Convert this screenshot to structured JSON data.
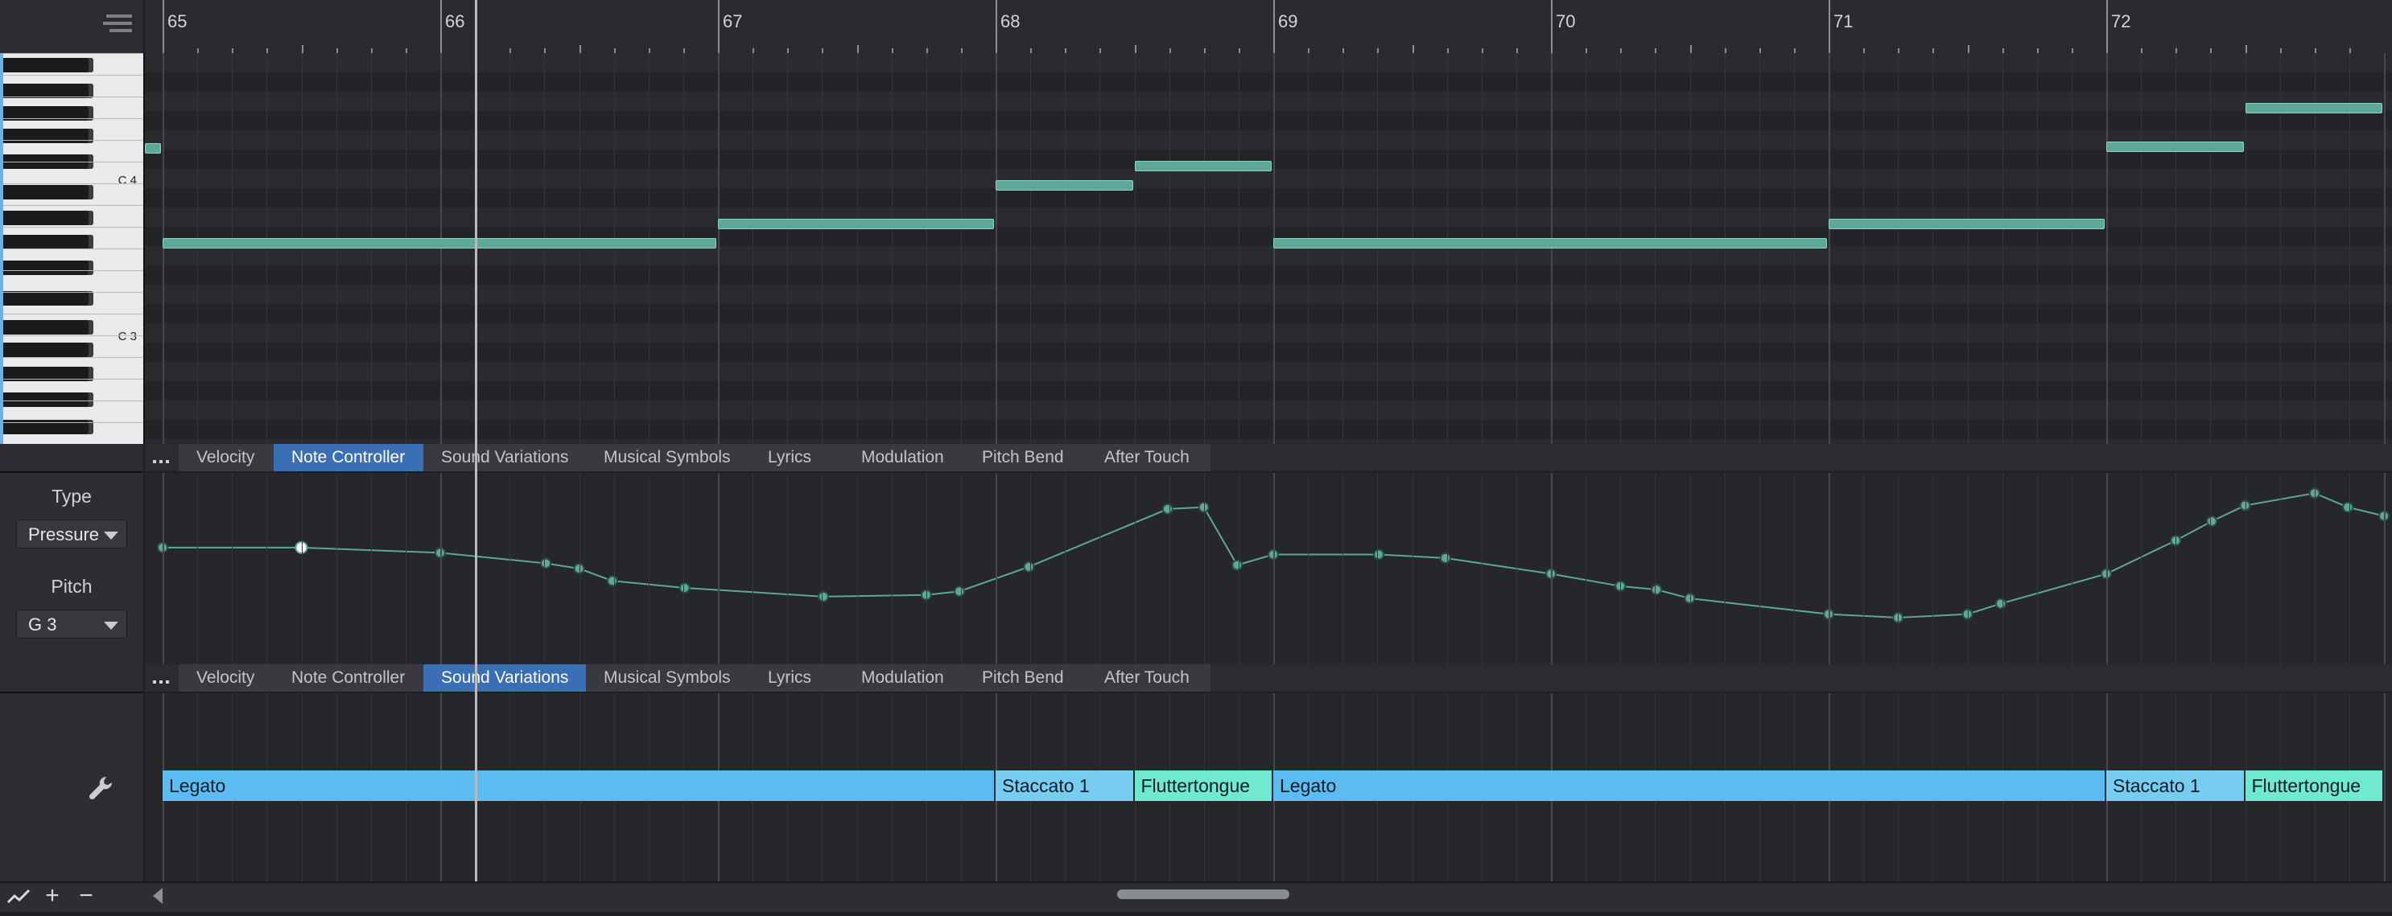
{
  "ruler": {
    "bars": [
      "65",
      "66",
      "67",
      "68",
      "69",
      "70",
      "71",
      "72"
    ]
  },
  "keyboard": {
    "labels": [
      "C 4",
      "C 3"
    ]
  },
  "notes": [
    {
      "start": 65.0,
      "end": 67.0,
      "row": 7
    },
    {
      "start": 67.0,
      "end": 68.0,
      "row": 6
    },
    {
      "start": 68.0,
      "end": 68.5,
      "row": 4
    },
    {
      "start": 68.5,
      "end": 69.0,
      "row": 3
    },
    {
      "start": 69.0,
      "end": 71.0,
      "row": 7
    },
    {
      "start": 71.0,
      "end": 72.0,
      "row": 6
    },
    {
      "start": 72.0,
      "end": 72.5,
      "row": 2
    },
    {
      "start": 72.5,
      "end": 73.0,
      "row": 0
    }
  ],
  "tabs_top": {
    "more": "...",
    "items": [
      "Velocity",
      "Note Controller",
      "Sound Variations",
      "Musical Symbols",
      "Lyrics",
      "Modulation",
      "Pitch Bend",
      "After Touch"
    ],
    "active": 1
  },
  "tabs_bottom": {
    "more": "...",
    "items": [
      "Velocity",
      "Note Controller",
      "Sound Variations",
      "Musical Symbols",
      "Lyrics",
      "Modulation",
      "Pitch Bend",
      "After Touch"
    ],
    "active": 2
  },
  "controller": {
    "type_label": "Type",
    "type_value": "Pressure",
    "pitch_label": "Pitch",
    "pitch_value": "G 3",
    "points": [
      [
        65.0,
        0.62
      ],
      [
        65.5,
        0.62
      ],
      [
        66.0,
        0.59
      ],
      [
        66.38,
        0.53
      ],
      [
        66.5,
        0.5
      ],
      [
        66.62,
        0.43
      ],
      [
        66.88,
        0.39
      ],
      [
        67.38,
        0.34
      ],
      [
        67.75,
        0.35
      ],
      [
        67.87,
        0.37
      ],
      [
        68.12,
        0.51
      ],
      [
        68.62,
        0.84
      ],
      [
        68.75,
        0.85
      ],
      [
        68.87,
        0.52
      ],
      [
        69.0,
        0.58
      ],
      [
        69.38,
        0.58
      ],
      [
        69.62,
        0.56
      ],
      [
        70.0,
        0.47
      ],
      [
        70.25,
        0.4
      ],
      [
        70.38,
        0.38
      ],
      [
        70.5,
        0.33
      ],
      [
        71.0,
        0.24
      ],
      [
        71.25,
        0.22
      ],
      [
        71.5,
        0.24
      ],
      [
        71.62,
        0.3
      ],
      [
        72.0,
        0.47
      ],
      [
        72.25,
        0.66
      ],
      [
        72.38,
        0.77
      ],
      [
        72.5,
        0.86
      ],
      [
        72.75,
        0.93
      ],
      [
        72.87,
        0.85
      ],
      [
        73.0,
        0.8
      ]
    ]
  },
  "sound_variations": [
    {
      "label": "Legato",
      "start": 65.0,
      "end": 68.0,
      "color": "#5bbcf2"
    },
    {
      "label": "Staccato 1",
      "start": 68.0,
      "end": 68.5,
      "color": "#77cdf0"
    },
    {
      "label": "Fluttertongue",
      "start": 68.5,
      "end": 69.0,
      "color": "#6fe9d0"
    },
    {
      "label": "Legato",
      "start": 69.0,
      "end": 72.0,
      "color": "#5bbcf2"
    },
    {
      "label": "Staccato 1",
      "start": 72.0,
      "end": 72.5,
      "color": "#77cdf0"
    },
    {
      "label": "Fluttertongue",
      "start": 72.5,
      "end": 73.0,
      "color": "#6fe9d0"
    }
  ],
  "bottom": {
    "plus": "+",
    "minus": "−"
  }
}
